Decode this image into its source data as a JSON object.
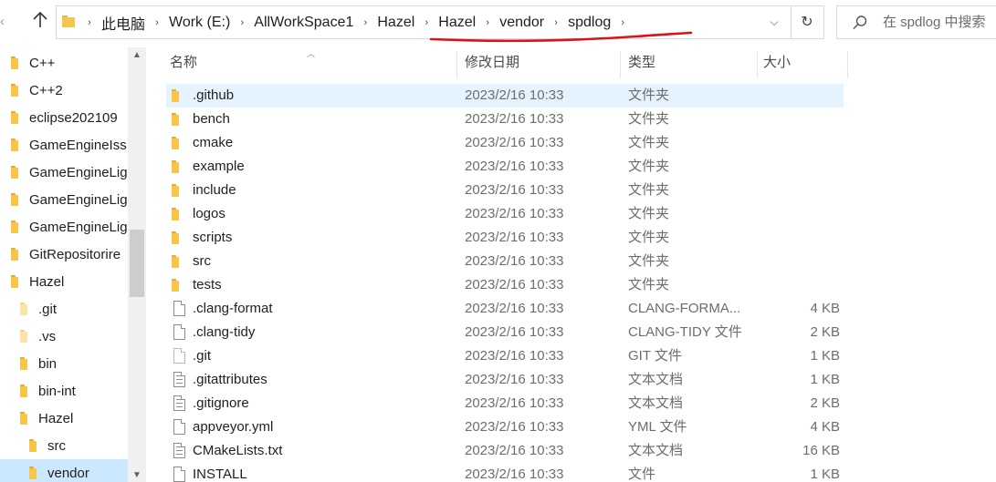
{
  "colors": {
    "accent_underline": "#d7141a",
    "selection": "#cce8ff",
    "folder": "#f7c648"
  },
  "address_bar": {
    "breadcrumbs": [
      "此电脑",
      "Work (E:)",
      "AllWorkSpace1",
      "Hazel",
      "Hazel",
      "vendor",
      "spdlog"
    ],
    "search_placeholder": "在 spdlog 中搜索"
  },
  "icons": {
    "back": "back-arrow-icon",
    "up": "up-arrow-icon",
    "refresh": "refresh-icon",
    "search": "search-icon",
    "dropdown": "chevron-down-icon"
  },
  "nav_pane": {
    "items": [
      {
        "label": "C++"
      },
      {
        "label": "C++2"
      },
      {
        "label": "eclipse202109"
      },
      {
        "label": "GameEngineIss"
      },
      {
        "label": "GameEngineLig"
      },
      {
        "label": "GameEngineLig"
      },
      {
        "label": "GameEngineLig"
      },
      {
        "label": "GitRepositorire"
      },
      {
        "label": "Hazel"
      },
      {
        "label": ".git"
      },
      {
        "label": ".vs"
      },
      {
        "label": "bin"
      },
      {
        "label": "bin-int"
      },
      {
        "label": "Hazel"
      },
      {
        "label": "src"
      },
      {
        "label": "vendor"
      }
    ]
  },
  "columns": {
    "name": "名称",
    "date": "修改日期",
    "type": "类型",
    "size": "大小"
  },
  "files": [
    {
      "name": ".github",
      "date": "2023/2/16 10:33",
      "type": "文件夹",
      "size": "",
      "kind": "folder"
    },
    {
      "name": "bench",
      "date": "2023/2/16 10:33",
      "type": "文件夹",
      "size": "",
      "kind": "folder"
    },
    {
      "name": "cmake",
      "date": "2023/2/16 10:33",
      "type": "文件夹",
      "size": "",
      "kind": "folder"
    },
    {
      "name": "example",
      "date": "2023/2/16 10:33",
      "type": "文件夹",
      "size": "",
      "kind": "folder"
    },
    {
      "name": "include",
      "date": "2023/2/16 10:33",
      "type": "文件夹",
      "size": "",
      "kind": "folder"
    },
    {
      "name": "logos",
      "date": "2023/2/16 10:33",
      "type": "文件夹",
      "size": "",
      "kind": "folder"
    },
    {
      "name": "scripts",
      "date": "2023/2/16 10:33",
      "type": "文件夹",
      "size": "",
      "kind": "folder"
    },
    {
      "name": "src",
      "date": "2023/2/16 10:33",
      "type": "文件夹",
      "size": "",
      "kind": "folder"
    },
    {
      "name": "tests",
      "date": "2023/2/16 10:33",
      "type": "文件夹",
      "size": "",
      "kind": "folder"
    },
    {
      "name": ".clang-format",
      "date": "2023/2/16 10:33",
      "type": "CLANG-FORMA...",
      "size": "4 KB",
      "kind": "file"
    },
    {
      "name": ".clang-tidy",
      "date": "2023/2/16 10:33",
      "type": "CLANG-TIDY 文件",
      "size": "2 KB",
      "kind": "file"
    },
    {
      "name": ".git",
      "date": "2023/2/16 10:33",
      "type": "GIT 文件",
      "size": "1 KB",
      "kind": "file"
    },
    {
      "name": ".gitattributes",
      "date": "2023/2/16 10:33",
      "type": "文本文档",
      "size": "1 KB",
      "kind": "text"
    },
    {
      "name": ".gitignore",
      "date": "2023/2/16 10:33",
      "type": "文本文档",
      "size": "2 KB",
      "kind": "text"
    },
    {
      "name": "appveyor.yml",
      "date": "2023/2/16 10:33",
      "type": "YML 文件",
      "size": "4 KB",
      "kind": "file"
    },
    {
      "name": "CMakeLists.txt",
      "date": "2023/2/16 10:33",
      "type": "文本文档",
      "size": "16 KB",
      "kind": "text"
    },
    {
      "name": "INSTALL",
      "date": "2023/2/16 10:33",
      "type": "文件",
      "size": "1 KB",
      "kind": "file"
    }
  ]
}
